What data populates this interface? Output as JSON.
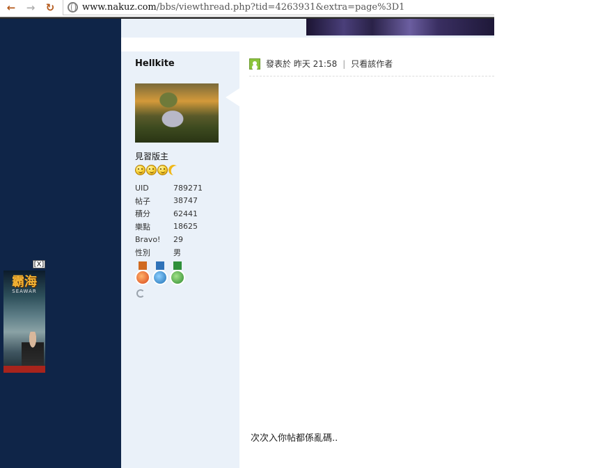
{
  "browser": {
    "back_icon": "back-arrow-icon",
    "forward_icon": "forward-arrow-icon",
    "reload_icon": "reload-icon",
    "url_domain": "www.nakuz.com",
    "url_path": "/bbs/viewthread.php?tid=4263931&extra=page%3D1"
  },
  "ad": {
    "close_label": "[X]",
    "logo_text": "霸海",
    "sub_text": "SEAWAR"
  },
  "author": {
    "name": "Hellkite",
    "title": "見習版主",
    "stats": [
      {
        "label": "UID",
        "value": "789271"
      },
      {
        "label": "帖子",
        "value": "38747"
      },
      {
        "label": "積分",
        "value": "62441"
      },
      {
        "label": "樂點",
        "value": "18625"
      },
      {
        "label": "Bravo!",
        "value": "29"
      },
      {
        "label": "性別",
        "value": "男"
      }
    ]
  },
  "post": {
    "posted_prefix": "發表於",
    "posted_time": "昨天 21:58",
    "separator": "|",
    "only_author_link": "只看該作者",
    "body": "次次入你帖都係亂碼.."
  },
  "colors": {
    "left_panel": "#0f2548",
    "author_bg": "#eaf1f9",
    "header_strip": "#eaf1f9"
  }
}
